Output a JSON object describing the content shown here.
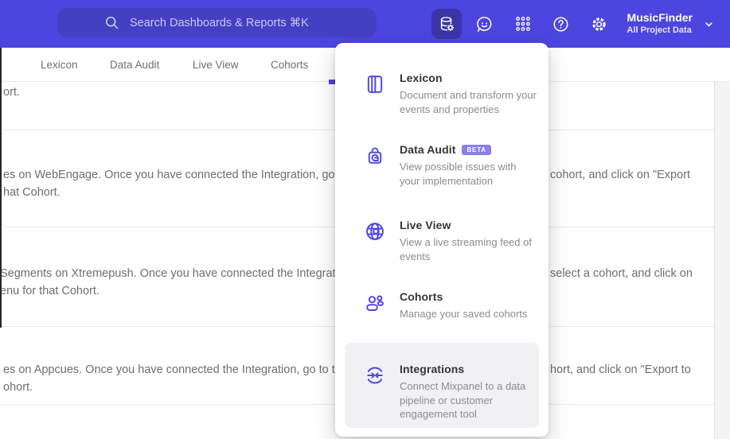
{
  "header": {
    "search_placeholder": "Search Dashboards & Reports ⌘K",
    "project_name": "MusicFinder",
    "project_subtitle": "All Project Data",
    "accent_color": "#4c45e0",
    "icons": [
      "search-icon",
      "data-management-icon",
      "feedback-icon",
      "apps-grid-icon",
      "help-icon",
      "settings-gear-icon",
      "chevron-down-icon"
    ]
  },
  "tabs": [
    {
      "label": "Lexicon"
    },
    {
      "label": "Data Audit"
    },
    {
      "label": "Live View"
    },
    {
      "label": "Cohorts"
    }
  ],
  "content": {
    "rows": [
      {
        "left_lines": [
          "ort.",
          ""
        ],
        "right_lines": [
          ""
        ]
      },
      {
        "left_lines": [
          "es on WebEngage. Once you have connected the Integration, go to the",
          "hat Cohort."
        ],
        "right_lines": [
          "cohort, and click on \"Export"
        ]
      },
      {
        "left_lines": [
          "Segments on Xtremepush. Once you have connected the Integration,",
          "enu for that Cohort."
        ],
        "right_lines": [
          "select a cohort, and click on"
        ]
      },
      {
        "left_lines": [
          "es on Appcues. Once you have connected the Integration, go to the M",
          "ohort."
        ],
        "right_lines": [
          "hort, and click on \"Export to"
        ]
      }
    ]
  },
  "menu": {
    "items": [
      {
        "title": "Lexicon",
        "description": "Document and transform your events and properties",
        "icon": "book-icon"
      },
      {
        "title": "Data Audit",
        "badge": "BETA",
        "description": "View possible issues with your implementation",
        "icon": "audit-lock-icon"
      },
      {
        "title": "Live View",
        "description": "View a live streaming feed of events",
        "icon": "globe-icon"
      },
      {
        "title": "Cohorts",
        "description": "Manage your saved cohorts",
        "icon": "people-icon"
      },
      {
        "title": "Integrations",
        "description": "Connect Mixpanel to a data pipeline or customer engagement tool",
        "icon": "integrations-icon",
        "highlighted": true
      }
    ],
    "icon_color": "#5348e2",
    "badge_color": "#8a7ee9"
  }
}
